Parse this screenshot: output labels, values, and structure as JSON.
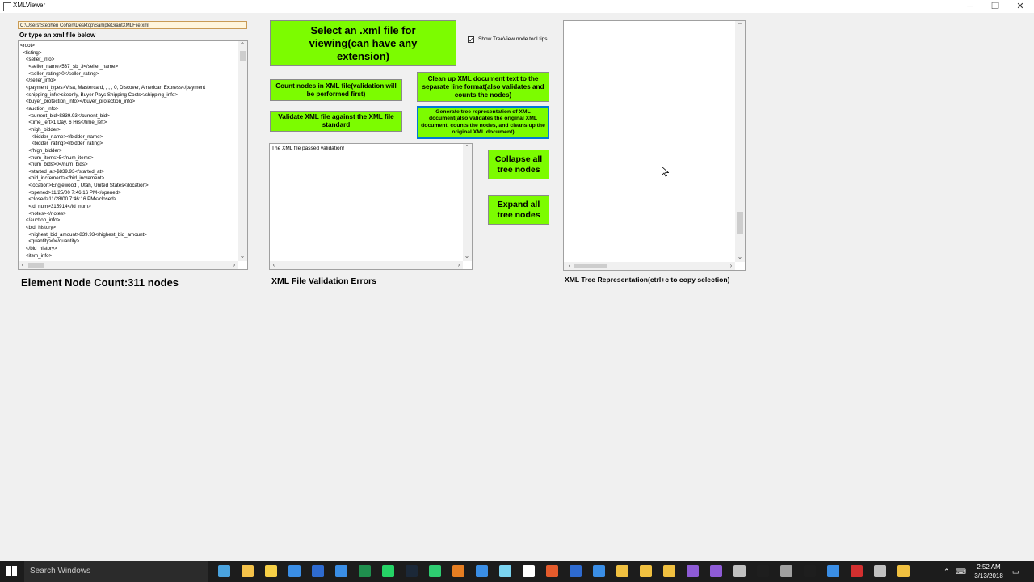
{
  "window": {
    "title": "XMLViewer",
    "minimize_glyph": "─",
    "maximize_glyph": "❐",
    "close_glyph": "✕"
  },
  "file_path": "C:\\Users\\Stephen Cohen\\Desktop\\SampleGiantXMLFile.xml",
  "or_type_label": "Or type an xml file below",
  "xml_lines": [
    "<root>",
    "  <listing>",
    "    <seller_info>",
    "      <seller_name>537_sb_3</seller_name>",
    "      <seller_rating>0</seller_rating>",
    "    </seller_info>",
    "    <payment_types>Visa, Mastercard, , , , 0, Discover, American Express</payment",
    "    <shipping_info>siteonly, Buyer Pays Shipping Costs</shipping_info>",
    "    <buyer_protection_info></buyer_protection_info>",
    "    <auction_info>",
    "      <current_bid>$839.93</current_bid>",
    "      <time_left>1 Day, 6 Hrs</time_left>",
    "      <high_bidder>",
    "        <bidder_name></bidder_name>",
    "        <bidder_rating></bidder_rating>",
    "      </high_bidder>",
    "      <num_items>5</num_items>",
    "      <num_bids>0</num_bids>",
    "      <started_at>$839.93</started_at>",
    "      <bid_increment></bid_increment>",
    "      <location>Englewood , Utah, United States</location>",
    "      <opened>11/25/00 7:46:16 PM</opened>",
    "      <closed>11/28/00 7:46:16 PM</closed>",
    "      <id_num>315914</id_num>",
    "      <notes></notes>",
    "    </auction_info>",
    "    <bid_history>",
    "      <highest_bid_amount>839.93</highest_bid_amount>",
    "      <quantity>0</quantity>",
    "    </bid_history>",
    "    <item_info>"
  ],
  "element_count_label": "Element Node Count:311 nodes",
  "buttons": {
    "select_file": "Select an .xml file for viewing(can have any extension)",
    "count_nodes": "Count nodes in XML file(validation will be performed first)",
    "validate": "Validate XML file against the XML file standard",
    "cleanup": "Clean up XML document text to the separate line format(also validates and counts the nodes)",
    "generate_tree": "Generate tree representation of XML document(also validates the original XML document, counts the nodes, and cleans up the original XML document)",
    "collapse": "Collapse all tree nodes",
    "expand": "Expand all tree nodes"
  },
  "checkbox": {
    "label": "Show TreeView node tool tips",
    "checked_glyph": "✓"
  },
  "validation_text": "The XML file passed validation!",
  "validation_label": "XML File Validation Errors",
  "tree_label": "XML Tree Representation(ctrl+c to copy selection)",
  "taskbar": {
    "search_placeholder": "Search Windows",
    "time": "2:52 AM",
    "date": "3/13/2018"
  },
  "taskbar_icon_colors": [
    "#4aa3df",
    "#f4c24a",
    "#f7d046",
    "#3a8ee6",
    "#2e6bd1",
    "#3a8ee6",
    "#1f8f4e",
    "#25d366",
    "#1b2838",
    "#2ecc71",
    "#e67e22",
    "#3a8ee6",
    "#7ad3f0",
    "#ffffff",
    "#e55b2c",
    "#2e6bd1",
    "#3a8ee6",
    "#f0c040",
    "#f0c040",
    "#f0c040",
    "#8e5bd6",
    "#8e5bd6",
    "#c0c0c0",
    "#1e1e1e",
    "#a0a0a0",
    "#1e1e1e",
    "#3a8ee6",
    "#d32f2f",
    "#c0c0c0",
    "#f0c040"
  ]
}
